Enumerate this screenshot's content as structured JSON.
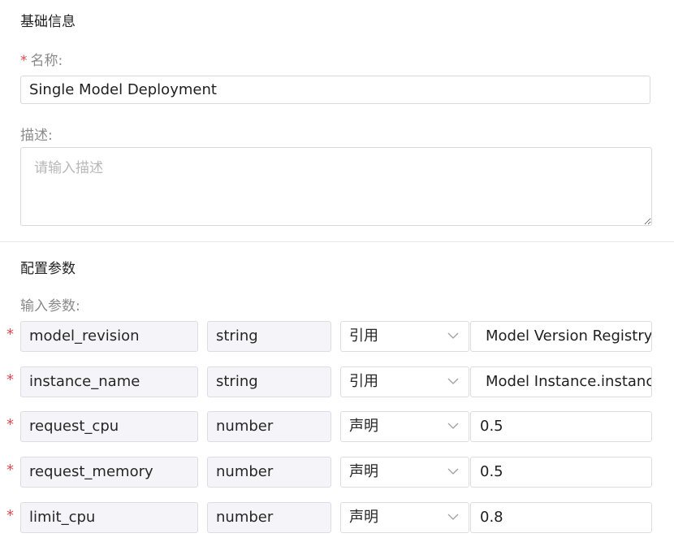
{
  "basic_info": {
    "section_title": "基础信息",
    "name_required_star": "*",
    "name_label": "名称:",
    "name_value": "Single Model Deployment",
    "desc_label": "描述:",
    "desc_placeholder": "请输入描述"
  },
  "config": {
    "section_title": "配置参数",
    "input_params_label": "输入参数:",
    "params": [
      {
        "required": "*",
        "name": "model_revision",
        "type": "string",
        "mode": "引用",
        "value": "Model Version Registry"
      },
      {
        "required": "*",
        "name": "instance_name",
        "type": "string",
        "mode": "引用",
        "value": "Model Instance.instance_name"
      },
      {
        "required": "*",
        "name": "request_cpu",
        "type": "number",
        "mode": "声明",
        "value": "0.5"
      },
      {
        "required": "*",
        "name": "request_memory",
        "type": "number",
        "mode": "声明",
        "value": "0.5"
      },
      {
        "required": "*",
        "name": "limit_cpu",
        "type": "number",
        "mode": "声明",
        "value": "0.8"
      }
    ]
  },
  "icons": {
    "dropdown": "chevron-down-icon"
  }
}
